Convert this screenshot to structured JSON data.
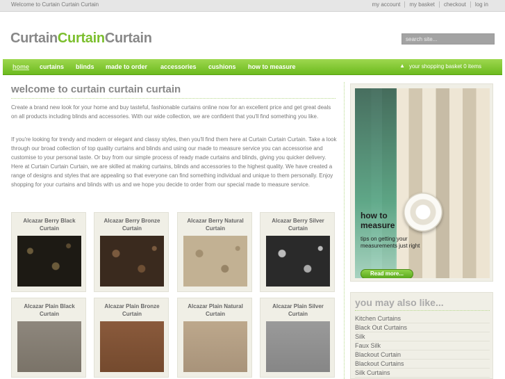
{
  "topbar": {
    "welcome": "Welcome to Curtain Curtain Curtain",
    "links": [
      "my account",
      "my basket",
      "checkout",
      "log in"
    ]
  },
  "logo": {
    "part1": "Curtain",
    "part2": "Curtain",
    "part3": "Curtain"
  },
  "search": {
    "placeholder": "search site..."
  },
  "nav": {
    "items": [
      "home",
      "curtains",
      "blinds",
      "made to order",
      "accessories",
      "cushions",
      "how to measure"
    ],
    "basket": "your shopping basket 0 items"
  },
  "main": {
    "heading": "welcome to curtain curtain curtain",
    "para1": "Create a brand new look for your home and buy tasteful, fashionable curtains online now for an excellent price and get great deals on all products including blinds and accessories. With our wide collection, we are confident that you'll find something you like.",
    "para2": "If you're looking for trendy and modern or elegant and classy styles, then you'll find them here at Curtain Curtain Curtain. Take a look through our broad collection of top quality curtains and blinds and using our made to measure service you can accessorise and customise to your personal taste. Or buy from our simple process of ready made curtains and blinds, giving you quicker delivery. Here at Curtain Curtain Curtain, we are skilled at making curtains, blinds and accessories to the highest quality. We have created a range of designs and styles that are appealing so that everyone can find something individual and unique to them personally. Enjoy shopping for your curtains and blinds with us and we hope you decide to order from our special made to measure service."
  },
  "products": [
    "Alcazar Berry Black Curtain",
    "Alcazar Berry Bronze Curtain",
    "Alcazar Berry Natural Curtain",
    "Alcazar Berry Silver Curtain",
    "Alcazar Plain Black Curtain",
    "Alcazar Plain Bronze Curtain",
    "Alcazar Plain Natural Curtain",
    "Alcazar Plain Silver Curtain"
  ],
  "promo": {
    "heading_line1": "how to",
    "heading_line2": "measure",
    "tips": "tips on getting your measurements just right",
    "button": "Read more..."
  },
  "also": {
    "heading": "you may also like...",
    "items": [
      "Kitchen Curtains",
      "Black Out Curtains",
      "Silk",
      "Faux Silk",
      "Blackout Curtain",
      "Blackout Curtains",
      "Silk Curtains"
    ]
  },
  "colors": {
    "accent": "#7cbf2e",
    "nav": "#6cba1e",
    "text": "#777777"
  }
}
